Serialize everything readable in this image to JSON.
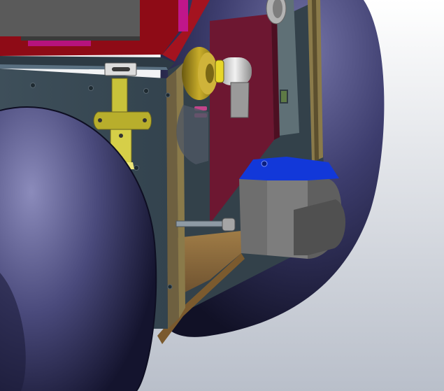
{
  "viewport": {
    "background_top": "#ffffff",
    "background_bottom": "#b9bfca"
  },
  "colors": {
    "wheel_dark": "#14142e",
    "wheel_mid": "#3d3d6e",
    "wheel_light": "#8b8bbb",
    "panel": "#3c4d58",
    "panel_dark": "#2a3640",
    "red_plate": "#8e0b16",
    "maroon_board": "#6d1731",
    "brass": "#b59b1e",
    "latch_yellow": "#c9c23a",
    "bracket_gray": "#6e6e6e",
    "bracket_dark": "#3e3e3e",
    "highlight_blue": "#1238d9",
    "silver": "#d8d8d8",
    "wood": "#8a6a3a"
  },
  "icons": {
    "bolt": "bolt-icon",
    "screw": "screw-icon"
  }
}
